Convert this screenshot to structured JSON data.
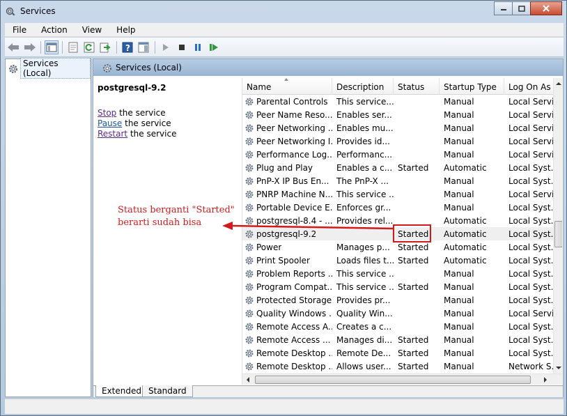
{
  "window": {
    "title": "Services"
  },
  "menu": [
    "File",
    "Action",
    "View",
    "Help"
  ],
  "tree": {
    "root_label": "Services (Local)"
  },
  "main": {
    "header_label": "Services (Local)",
    "selected_service": "postgresql-9.2",
    "actions": [
      {
        "link": "Stop",
        "rest": " the service"
      },
      {
        "link": "Pause",
        "rest": " the service"
      },
      {
        "link": "Restart",
        "rest": " the service"
      }
    ]
  },
  "table": {
    "columns": [
      "Name",
      "Description",
      "Status",
      "Startup Type",
      "Log On As"
    ],
    "rows": [
      {
        "name": "Parental Controls",
        "description": "This service...",
        "status": "",
        "startup": "Manual",
        "logon": "Local Servi..."
      },
      {
        "name": "Peer Name Reso...",
        "description": "Enables ser...",
        "status": "",
        "startup": "Manual",
        "logon": "Local Servi..."
      },
      {
        "name": "Peer Networking ...",
        "description": "Enables mu...",
        "status": "",
        "startup": "Manual",
        "logon": "Local Servi..."
      },
      {
        "name": "Peer Networking I...",
        "description": "Provides id...",
        "status": "",
        "startup": "Manual",
        "logon": "Local Servi..."
      },
      {
        "name": "Performance Log...",
        "description": "Performanc...",
        "status": "",
        "startup": "Manual",
        "logon": "Local Servi..."
      },
      {
        "name": "Plug and Play",
        "description": "Enables a c...",
        "status": "Started",
        "startup": "Automatic",
        "logon": "Local Syst..."
      },
      {
        "name": "PnP-X IP Bus En...",
        "description": "The PnP-X ...",
        "status": "",
        "startup": "Manual",
        "logon": "Local Syst..."
      },
      {
        "name": "PNRP Machine N...",
        "description": "This service ...",
        "status": "",
        "startup": "Manual",
        "logon": "Local Servi..."
      },
      {
        "name": "Portable Device E...",
        "description": "Enforces gr...",
        "status": "",
        "startup": "Manual",
        "logon": "Local Syst..."
      },
      {
        "name": "postgresql-8.4 - ...",
        "description": "Provides rel...",
        "status": "",
        "startup": "Automatic",
        "logon": "Local Syst..."
      },
      {
        "name": "postgresql-9.2",
        "description": "",
        "status": "Started",
        "startup": "Automatic",
        "logon": "Local Syst..."
      },
      {
        "name": "Power",
        "description": "Manages p...",
        "status": "Started",
        "startup": "Automatic",
        "logon": "Local Syst..."
      },
      {
        "name": "Print Spooler",
        "description": "Loads files t...",
        "status": "Started",
        "startup": "Automatic",
        "logon": "Local Syst..."
      },
      {
        "name": "Problem Reports ...",
        "description": "This service ...",
        "status": "",
        "startup": "Manual",
        "logon": "Local Syst..."
      },
      {
        "name": "Program Compat...",
        "description": "This service ...",
        "status": "Started",
        "startup": "Manual",
        "logon": "Local Syst..."
      },
      {
        "name": "Protected Storage",
        "description": "Provides pr...",
        "status": "",
        "startup": "Manual",
        "logon": "Local Syst..."
      },
      {
        "name": "Quality Windows ...",
        "description": "Quality Win...",
        "status": "",
        "startup": "Manual",
        "logon": "Local Servi..."
      },
      {
        "name": "Remote Access A...",
        "description": "Creates a c...",
        "status": "",
        "startup": "Manual",
        "logon": "Local Syst..."
      },
      {
        "name": "Remote Access ...",
        "description": "Manages di...",
        "status": "Started",
        "startup": "Manual",
        "logon": "Local Syst..."
      },
      {
        "name": "Remote Desktop ...",
        "description": "Remote De...",
        "status": "Started",
        "startup": "Manual",
        "logon": "Local Syst..."
      },
      {
        "name": "Remote Desktop ...",
        "description": "Allows user...",
        "status": "Started",
        "startup": "Manual",
        "logon": "Network S..."
      }
    ]
  },
  "tabs": [
    "Extended",
    "Standard"
  ],
  "annotation": {
    "line1": "Status berganti \"Started\"",
    "line2": "berarti sudah bisa",
    "color": "#d11a1a"
  }
}
